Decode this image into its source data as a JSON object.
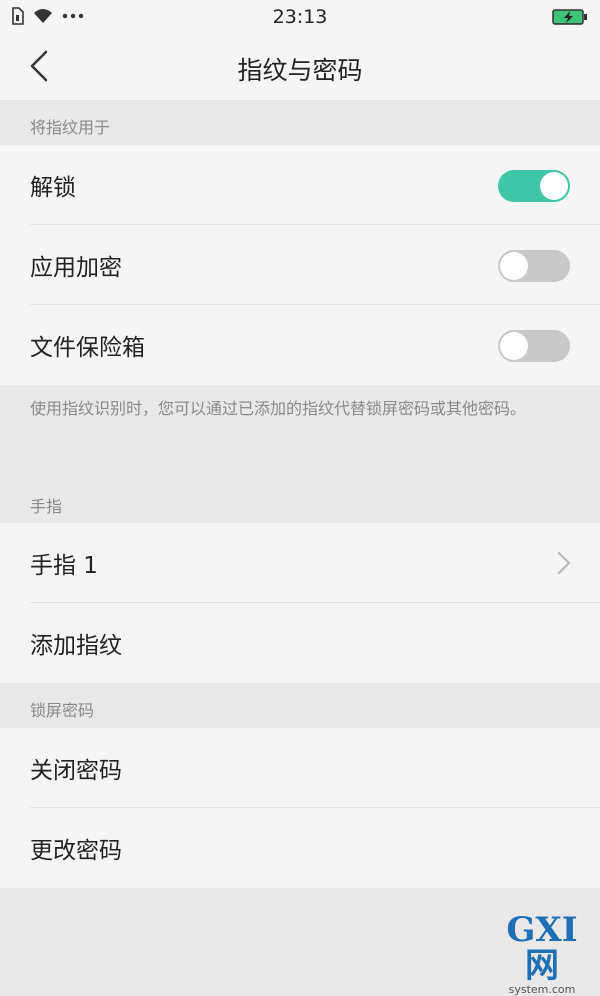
{
  "status_bar": {
    "time": "23:13",
    "left_icons": [
      "sim-icon",
      "wifi-icon",
      "more-dots-icon"
    ],
    "battery_color": "#3fc27a"
  },
  "header": {
    "title": "指纹与密码",
    "back_icon": "chevron-left-icon"
  },
  "sections": {
    "fingerprint_use": {
      "header": "将指纹用于",
      "items": [
        {
          "label": "解锁",
          "toggle": true
        },
        {
          "label": "应用加密",
          "toggle": false
        },
        {
          "label": "文件保险箱",
          "toggle": false
        }
      ],
      "note": "使用指纹识别时，您可以通过已添加的指纹代替锁屏密码或其他密码。"
    },
    "fingers": {
      "header": "手指",
      "items": [
        {
          "label": "手指 1",
          "chevron": true
        },
        {
          "label": "添加指纹"
        }
      ]
    },
    "lock_password": {
      "header": "锁屏密码",
      "items": [
        {
          "label": "关闭密码"
        },
        {
          "label": "更改密码"
        }
      ]
    }
  },
  "watermark": {
    "logo": "GXI网",
    "sub": "system.com"
  },
  "colors": {
    "toggle_on": "#3fc6a6",
    "toggle_off": "#c8c8c8",
    "section_bg": "#e8e8e8",
    "row_bg": "#f5f5f5"
  }
}
